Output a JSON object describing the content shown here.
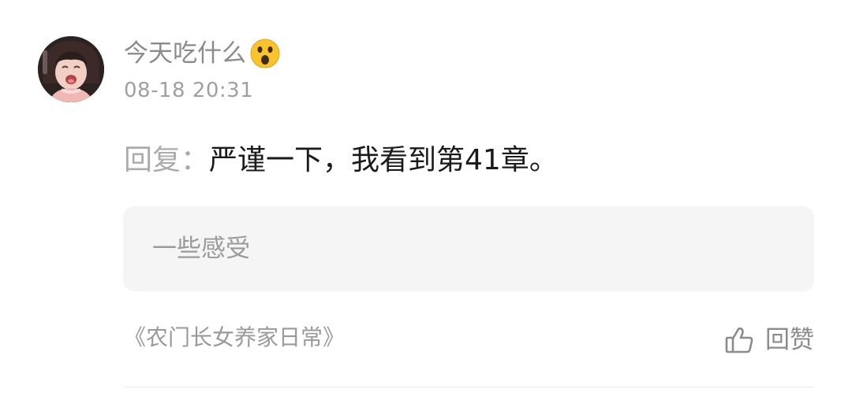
{
  "comment": {
    "author": {
      "name": "今天吃什么",
      "emoji_icon": "astonished-face-emoji"
    },
    "timestamp": "08-18 20:31",
    "reply_prefix": "回复：",
    "reply_text": "严谨一下，我看到第41章。",
    "quote_text": "一些感受",
    "book_title": "《农门长女养家日常》",
    "actions": {
      "reply_label": "回赞",
      "reply_icon": "thumbs-up-icon"
    }
  }
}
